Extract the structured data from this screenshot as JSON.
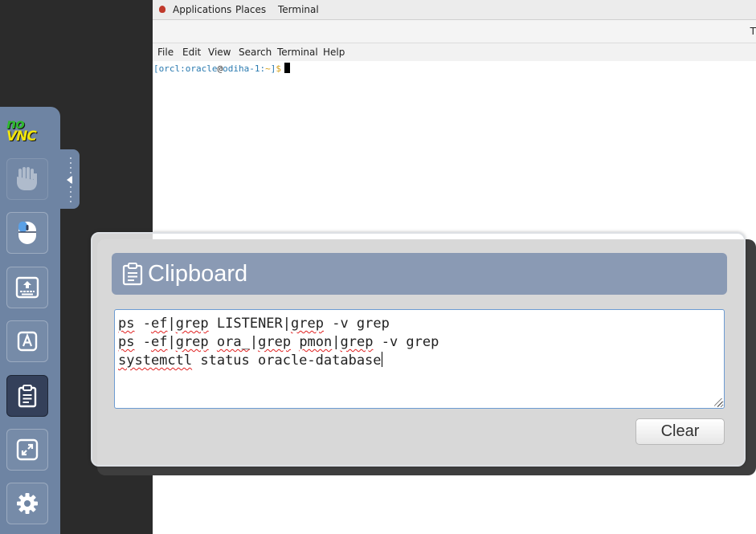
{
  "remote": {
    "topbar": {
      "applications": "Applications",
      "places": "Places",
      "terminal": "Terminal"
    },
    "window_title_fragment": "T",
    "menu": [
      "File",
      "Edit",
      "View",
      "Search",
      "Terminal",
      "Help"
    ],
    "prompt": {
      "open": "[",
      "user": "orcl:oracle",
      "at": "@",
      "host": "odiha-1:",
      "path": "~",
      "close": "]",
      "dollar": "$"
    }
  },
  "sidebar": {
    "logo_top": "no",
    "logo_bottom": "VNC",
    "buttons": [
      {
        "icon": "drag-hand-icon",
        "active": false
      },
      {
        "icon": "mouse-icon",
        "active": false
      },
      {
        "icon": "keyboard-icon",
        "active": false
      },
      {
        "icon": "extra-keys-icon",
        "active": false
      },
      {
        "icon": "clipboard-icon",
        "active": true
      },
      {
        "icon": "fullscreen-icon",
        "active": false
      },
      {
        "icon": "gear-icon",
        "active": false
      }
    ]
  },
  "clipboard": {
    "title": "Clipboard",
    "lines": [
      [
        {
          "t": "ps",
          "sp": true
        },
        {
          "t": " -",
          "sp": false
        },
        {
          "t": "ef",
          "sp": true
        },
        {
          "t": "|",
          "sp": false
        },
        {
          "t": "grep",
          "sp": true
        },
        {
          "t": " LISTENER",
          "sp": false
        },
        {
          "t": "|",
          "sp": false
        },
        {
          "t": "grep",
          "sp": true
        },
        {
          "t": " -v grep",
          "sp": false
        }
      ],
      [
        {
          "t": "ps",
          "sp": true
        },
        {
          "t": " -",
          "sp": false
        },
        {
          "t": "ef",
          "sp": true
        },
        {
          "t": "|",
          "sp": false
        },
        {
          "t": "grep",
          "sp": true
        },
        {
          "t": " ",
          "sp": false
        },
        {
          "t": "ora_",
          "sp": true
        },
        {
          "t": "|",
          "sp": false
        },
        {
          "t": "grep",
          "sp": true
        },
        {
          "t": " ",
          "sp": false
        },
        {
          "t": "pmon",
          "sp": true
        },
        {
          "t": "|",
          "sp": false
        },
        {
          "t": "grep",
          "sp": true
        },
        {
          "t": " -v grep",
          "sp": false
        }
      ],
      [
        {
          "t": "systemctl",
          "sp": true
        },
        {
          "t": " status oracle-database",
          "sp": false
        }
      ]
    ],
    "clear_label": "Clear"
  }
}
